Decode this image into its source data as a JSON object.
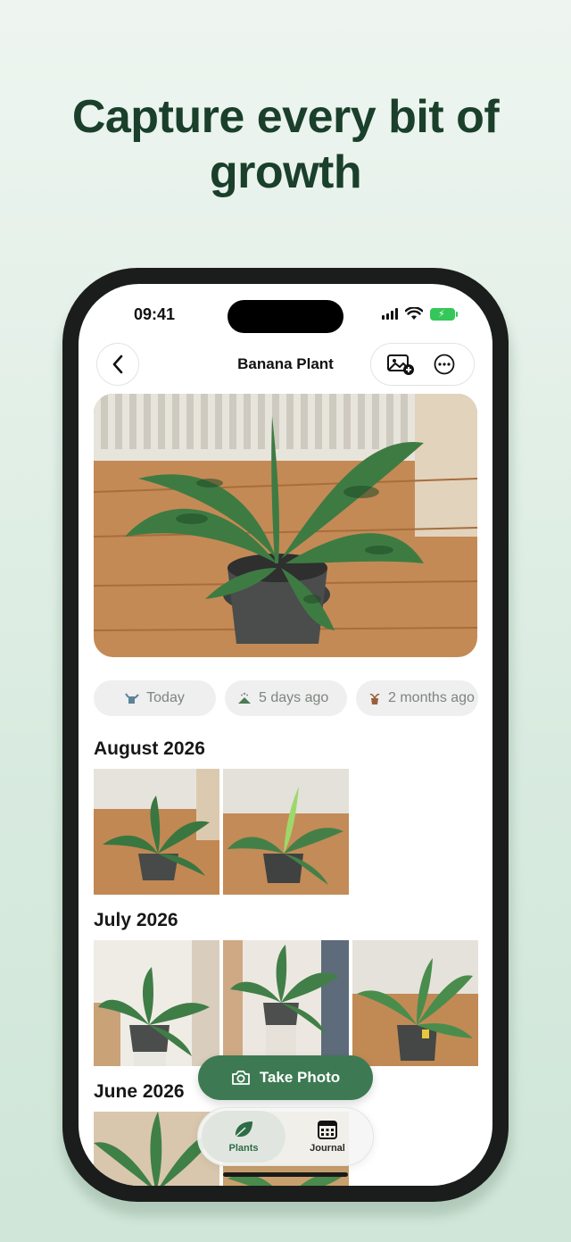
{
  "headline": {
    "line1": "Capture every bit of",
    "line2": "growth"
  },
  "status_bar": {
    "time": "09:41"
  },
  "nav": {
    "title": "Banana Plant"
  },
  "chips": [
    {
      "label": "Today",
      "icon": "watering-can-icon"
    },
    {
      "label": "5 days ago",
      "icon": "fertilizer-icon"
    },
    {
      "label": "2 months ago",
      "icon": "repot-icon"
    }
  ],
  "sections": [
    {
      "title": "August 2026",
      "photo_count": 2
    },
    {
      "title": "July 2026",
      "photo_count": 3
    },
    {
      "title": "June 2026",
      "photo_count": 2
    }
  ],
  "take_photo": {
    "label": "Take Photo"
  },
  "tabs": [
    {
      "label": "Plants",
      "icon": "leaf-icon",
      "active": true
    },
    {
      "label": "Journal",
      "icon": "calendar-icon",
      "active": false
    }
  ],
  "colors": {
    "brand_green": "#3d7a53",
    "headline": "#1a3f2b",
    "background": "#d9ebe0"
  }
}
